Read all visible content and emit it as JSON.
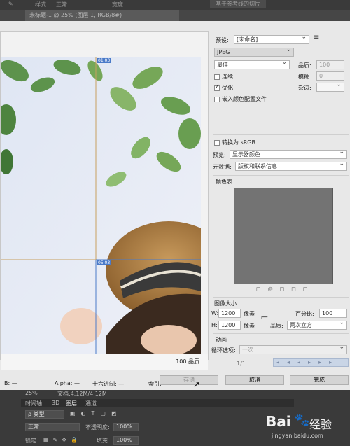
{
  "top_bar": {
    "style_label": "样式:",
    "style_value": "正常",
    "width_label": "宽度:",
    "doc_tab": "未标题-1 @ 25% (图层 1, RGB/8#)",
    "right_button": "基于参考线的切片"
  },
  "settings": {
    "preset_label": "预设:",
    "preset_value": "[未命名]",
    "format_value": "JPEG",
    "quality_preset": "最佳",
    "quality_label": "品质:",
    "quality_value": "100",
    "progressive_label": "连续",
    "blur_label": "模糊:",
    "blur_value": "0",
    "optimized_label": "优化",
    "matte_label": "杂边:",
    "embed_profile_label": "嵌入颜色配置文件",
    "convert_srgb_label": "转换为 sRGB",
    "preview_label": "预览:",
    "preview_value": "显示器颜色",
    "metadata_label": "元数据:",
    "metadata_value": "版权和联系信息"
  },
  "color_table": {
    "title": "颜色表"
  },
  "image_size": {
    "title": "图像大小",
    "w_label": "W:",
    "w_value": "1200",
    "h_label": "H:",
    "h_value": "1200",
    "unit": "像素",
    "percent_label": "百分比:",
    "percent_value": "100",
    "quality_label": "品质:",
    "quality_value": "两次立方"
  },
  "animation": {
    "title": "动画",
    "loop_label": "循环选项:",
    "loop_value": "一次",
    "frame_counter": "1/1"
  },
  "preview": {
    "slice_label_1": "01 03",
    "slice_label_2": "05 03",
    "quality_info": "100 品质"
  },
  "status": {
    "b": "B: —",
    "alpha": "Alpha: —",
    "hex": "十六进制: —",
    "index": "索引: —"
  },
  "buttons": {
    "save": "存储",
    "cancel": "取消",
    "done": "完成"
  },
  "layers_panel": {
    "zoom": "25%",
    "doc_info": "文档:4.12M/4.12M",
    "tabs": [
      "时间轴",
      "3D",
      "图层",
      "通道"
    ],
    "kind_label": "ρ 类型",
    "blend_mode": "正常",
    "opacity_label": "不透明度:",
    "opacity_value": "100%",
    "lock_label": "锁定:",
    "fill_label": "填充:",
    "fill_value": "100%"
  },
  "watermark": {
    "brand": "Bai",
    "brand_suffix": "经验",
    "url": "jingyan.baidu.com"
  }
}
